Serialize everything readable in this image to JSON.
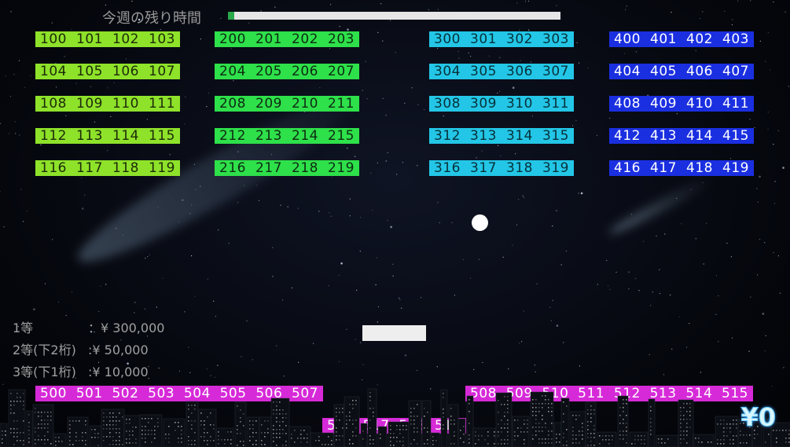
{
  "timer": {
    "label": "今週の残り時間",
    "remaining_fraction": 0.02
  },
  "bricks": {
    "group1": [
      [
        "100",
        "101",
        "102",
        "103"
      ],
      [
        "104",
        "105",
        "106",
        "107"
      ],
      [
        "108",
        "109",
        "110",
        "111"
      ],
      [
        "112",
        "113",
        "114",
        "115"
      ],
      [
        "116",
        "117",
        "118",
        "119"
      ]
    ],
    "group2": [
      [
        "200",
        "201",
        "202",
        "203"
      ],
      [
        "204",
        "205",
        "206",
        "207"
      ],
      [
        "208",
        "209",
        "210",
        "211"
      ],
      [
        "212",
        "213",
        "214",
        "215"
      ],
      [
        "216",
        "217",
        "218",
        "219"
      ]
    ],
    "group3": [
      [
        "300",
        "301",
        "302",
        "303"
      ],
      [
        "304",
        "305",
        "306",
        "307"
      ],
      [
        "308",
        "309",
        "310",
        "311"
      ],
      [
        "312",
        "313",
        "314",
        "315"
      ],
      [
        "316",
        "317",
        "318",
        "319"
      ]
    ],
    "group4": [
      [
        "400",
        "401",
        "402",
        "403"
      ],
      [
        "404",
        "405",
        "406",
        "407"
      ],
      [
        "408",
        "409",
        "410",
        "411"
      ],
      [
        "412",
        "413",
        "414",
        "415"
      ],
      [
        "416",
        "417",
        "418",
        "419"
      ]
    ],
    "group5_left": [
      "500",
      "501",
      "502",
      "503",
      "504",
      "505",
      "506",
      "507"
    ],
    "group5_right": [
      "508",
      "509",
      "510",
      "511",
      "512",
      "513",
      "514",
      "515"
    ],
    "group5_bottom": [
      "516",
      "517",
      "518",
      "519"
    ]
  },
  "prizes": [
    {
      "name": "1等",
      "amount": "：¥ 300,000"
    },
    {
      "name": "2等(下2桁)",
      "amount": ":¥ 50,000"
    },
    {
      "name": "3等(下1桁)",
      "amount": ":¥ 10,000"
    }
  ],
  "score": "¥0",
  "colors": {
    "group1": "#8ee22a",
    "group2": "#2ee04a",
    "group3": "#23c6e6",
    "group4": "#1a2fe0",
    "group5": "#d62ad8",
    "timer_fill": "#2aa84a"
  },
  "icons": {
    "ball": "ball-icon",
    "paddle": "paddle-icon"
  }
}
